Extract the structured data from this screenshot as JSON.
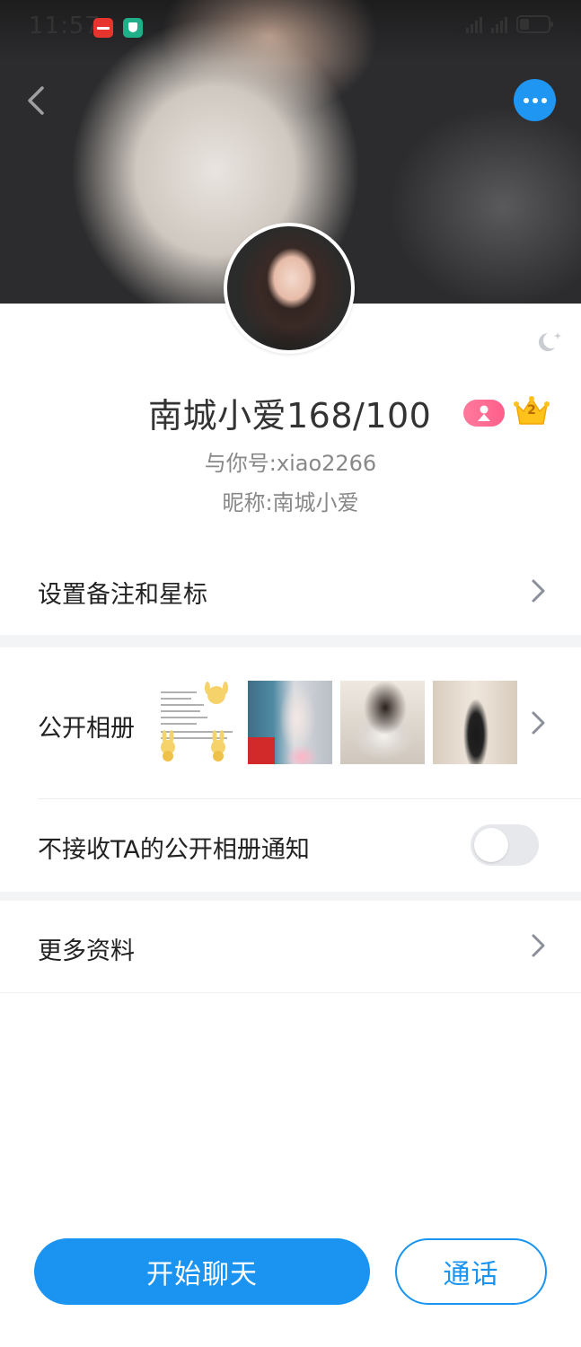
{
  "status_bar": {
    "time": "11:57"
  },
  "profile": {
    "nickname_display": "南城小爱168/100",
    "level_number": "2",
    "account_id": "与你号:xiao2266",
    "nickname_line": "昵称:南城小爱"
  },
  "menu": {
    "remark_label": "设置备注和星标",
    "album_label": "公开相册",
    "notify_label": "不接收TA的公开相册通知",
    "notify_enabled": false,
    "more_label": "更多资料"
  },
  "actions": {
    "chat_label": "开始聊天",
    "call_label": "通话"
  },
  "colors": {
    "accent": "#1a94f0",
    "gender_badge": "#ff6b90",
    "crown": "#ffc21a"
  },
  "icons": [
    "back-arrow-icon",
    "more-dots-icon",
    "theme-moon-icon",
    "female-icon",
    "crown-icon",
    "chevron-right-icon"
  ]
}
